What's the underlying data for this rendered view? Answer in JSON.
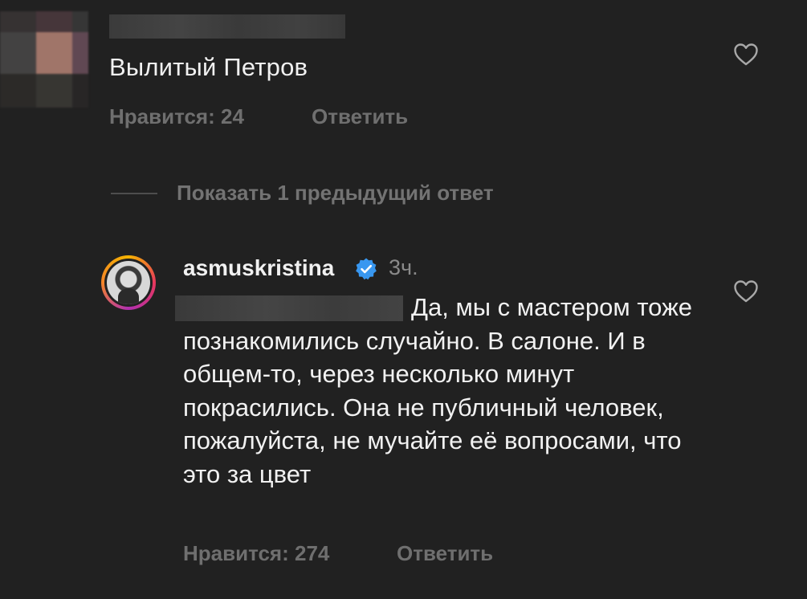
{
  "comment1": {
    "text": "Вылитый Петров",
    "likes": "Нравится: 24",
    "reply_label": "Ответить"
  },
  "thread": {
    "show_replies_label": "Показать 1 предыдущий ответ"
  },
  "reply": {
    "username": "asmuskristina",
    "time": "3ч.",
    "text": "Да, мы с мастером тоже познакомились случайно. В салоне. И в общем-то, через несколько минут покрасились. Она не публичный человек, пожалуйста, не мучайте её вопросами, что это за цвет",
    "likes": "Нравится: 274",
    "reply_label": "Ответить"
  },
  "colors": {
    "background": "#212121",
    "verified": "#3897f0"
  },
  "icons": {
    "like": "heart-outline-icon",
    "verified": "verified-badge-icon"
  }
}
